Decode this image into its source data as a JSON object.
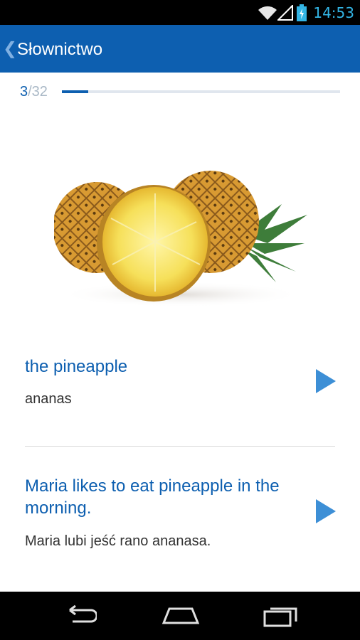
{
  "status_bar": {
    "time": "14:53",
    "icons": [
      "wifi-icon",
      "signal-icon",
      "battery-charging-icon"
    ]
  },
  "app_bar": {
    "back_icon": "chevron-left-icon",
    "title": "Słownictwo"
  },
  "progress": {
    "current": "3",
    "total": "/32",
    "fraction": 0.094
  },
  "image": {
    "subject": "pineapple"
  },
  "entries": [
    {
      "title": "the pineapple",
      "translation": "ananas",
      "play_icon": "play-icon"
    },
    {
      "title": "Maria likes to eat pineapple in the morning.",
      "translation": "Maria lubi jeść rano ananasa.",
      "play_icon": "play-icon"
    }
  ],
  "nav_bar": {
    "icons": [
      "back-icon",
      "home-icon",
      "recent-apps-icon"
    ]
  },
  "colors": {
    "accent": "#0d5fb0",
    "play": "#3d8fd6",
    "status_time": "#33b5e5"
  }
}
